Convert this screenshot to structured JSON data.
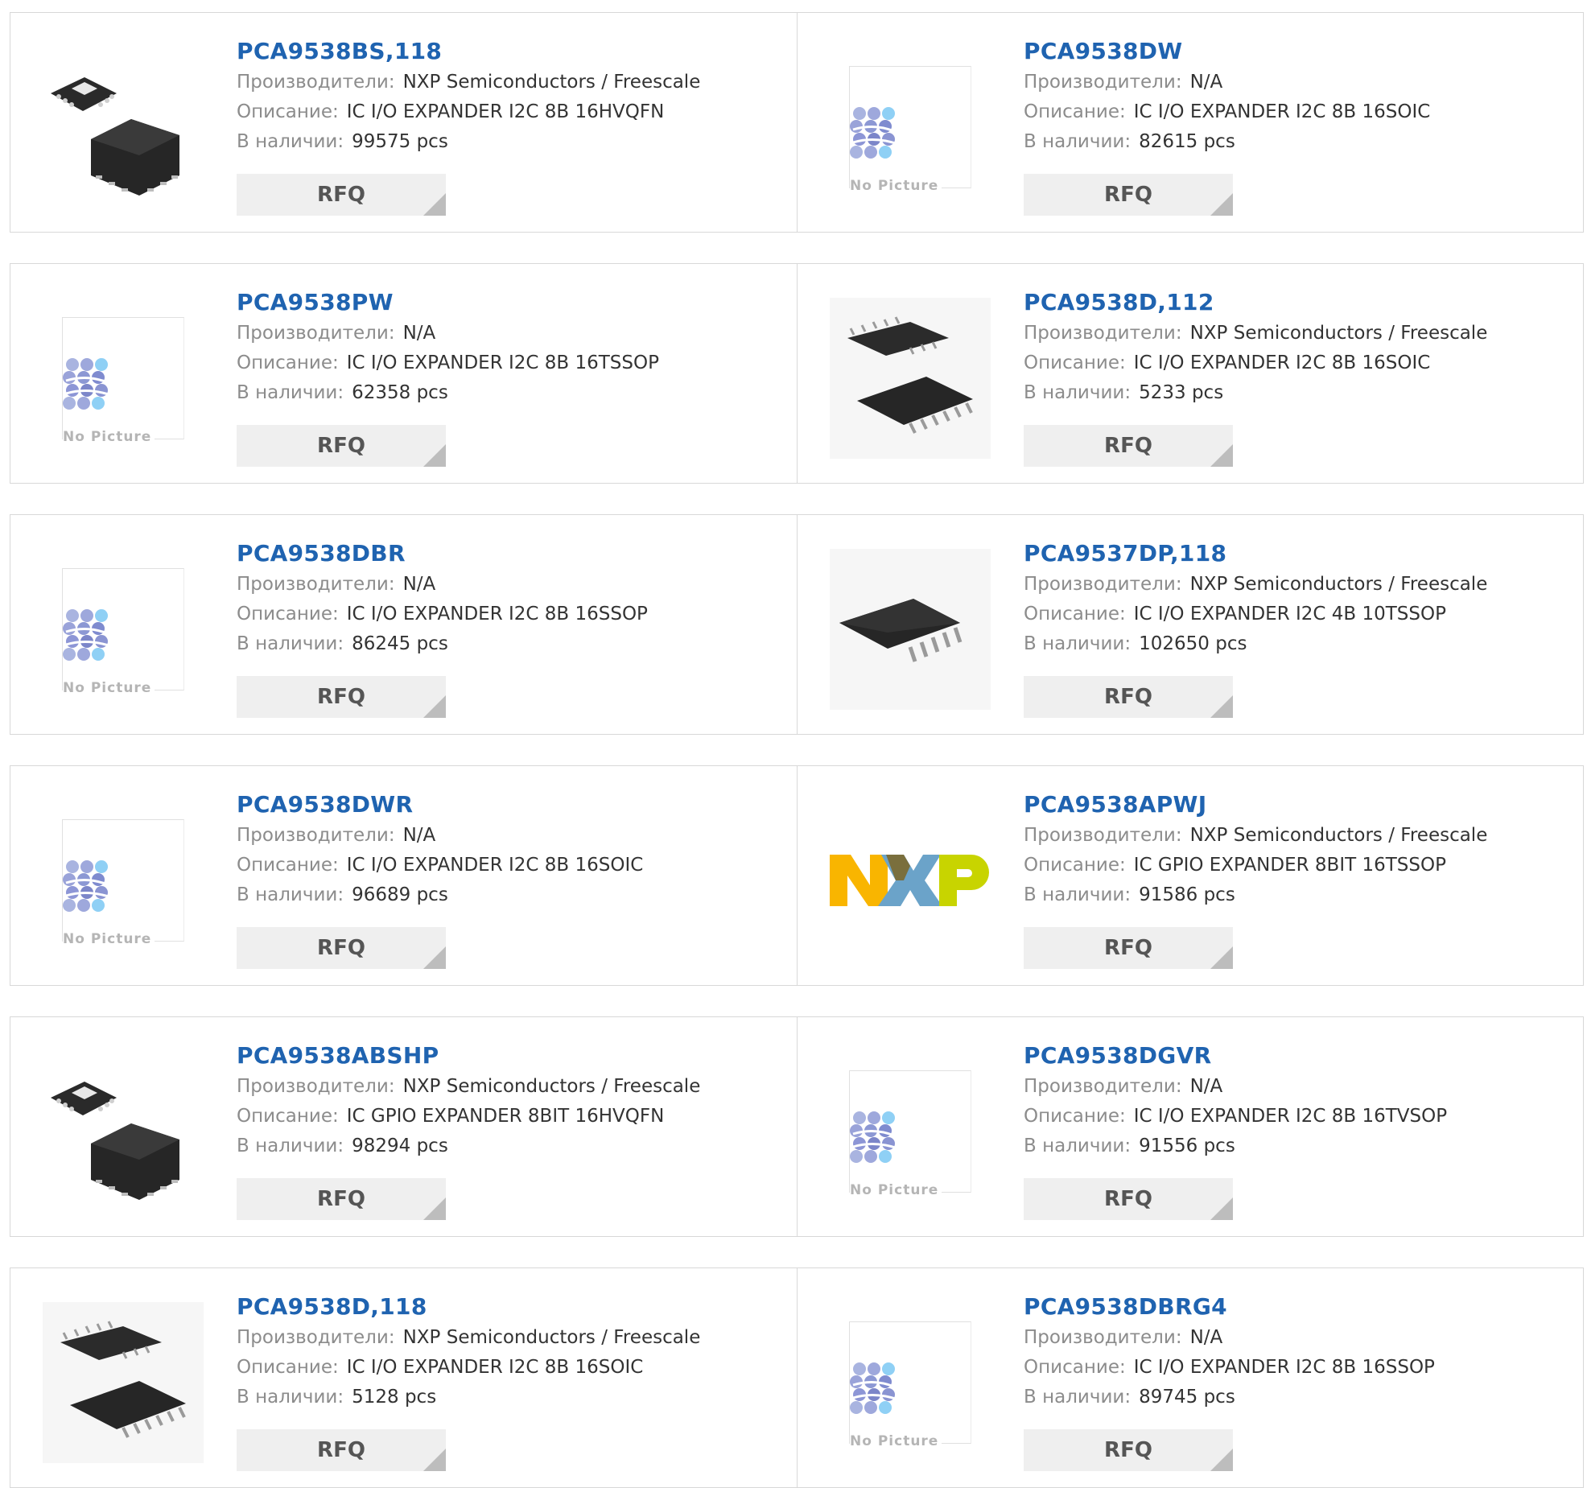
{
  "colors": {
    "part_number": "#1f63b0",
    "label": "#8c8c8c",
    "value": "#333333",
    "rfq_bg": "#efefef"
  },
  "rows": [
    {
      "left": {
        "pn": "PCA9538BS,118",
        "mfr_label": "Производители:",
        "mfr": "NXP Semiconductors / Freescale",
        "desc_label": "Описание:",
        "desc": "IC I/O EXPANDER I2C 8B 16HVQFN",
        "stock_label": "В наличии:",
        "stock": "99575 pcs",
        "rfq": "RFQ",
        "image": "qfn-chip-photo"
      },
      "right": {
        "pn": "PCA9538DW",
        "mfr_label": "Производители:",
        "mfr": "N/A",
        "desc_label": "Описание:",
        "desc": "IC I/O EXPANDER I2C 8B 16SOIC",
        "stock_label": "В наличии:",
        "stock": "82615 pcs",
        "rfq": "RFQ",
        "image": "no-picture",
        "no_picture_text": "No Picture"
      }
    },
    {
      "left": {
        "pn": "PCA9538PW",
        "mfr_label": "Производители:",
        "mfr": "N/A",
        "desc_label": "Описание:",
        "desc": "IC I/O EXPANDER I2C 8B 16TSSOP",
        "stock_label": "В наличии:",
        "stock": "62358 pcs",
        "rfq": "RFQ",
        "image": "no-picture",
        "no_picture_text": "No Picture"
      },
      "right": {
        "pn": "PCA9538D,112",
        "mfr_label": "Производители:",
        "mfr": "NXP Semiconductors / Freescale",
        "desc_label": "Описание:",
        "desc": "IC I/O EXPANDER I2C 8B 16SOIC",
        "stock_label": "В наличии:",
        "stock": "5233 pcs",
        "rfq": "RFQ",
        "image": "soic-chip-photo"
      }
    },
    {
      "left": {
        "pn": "PCA9538DBR",
        "mfr_label": "Производители:",
        "mfr": "N/A",
        "desc_label": "Описание:",
        "desc": "IC I/O EXPANDER I2C 8B 16SSOP",
        "stock_label": "В наличии:",
        "stock": "86245 pcs",
        "rfq": "RFQ",
        "image": "no-picture",
        "no_picture_text": "No Picture"
      },
      "right": {
        "pn": "PCA9537DP,118",
        "mfr_label": "Производители:",
        "mfr": "NXP Semiconductors / Freescale",
        "desc_label": "Описание:",
        "desc": "IC I/O EXPANDER I2C 4B 10TSSOP",
        "stock_label": "В наличии:",
        "stock": "102650 pcs",
        "rfq": "RFQ",
        "image": "tssop-chip-photo"
      }
    },
    {
      "left": {
        "pn": "PCA9538DWR",
        "mfr_label": "Производители:",
        "mfr": "N/A",
        "desc_label": "Описание:",
        "desc": "IC I/O EXPANDER I2C 8B 16SOIC",
        "stock_label": "В наличии:",
        "stock": "96689 pcs",
        "rfq": "RFQ",
        "image": "no-picture",
        "no_picture_text": "No Picture"
      },
      "right": {
        "pn": "PCA9538APWJ",
        "mfr_label": "Производители:",
        "mfr": "NXP Semiconductors / Freescale",
        "desc_label": "Описание:",
        "desc": "IC GPIO EXPANDER 8BIT 16TSSOP",
        "stock_label": "В наличии:",
        "stock": "91586 pcs",
        "rfq": "RFQ",
        "image": "nxp-logo"
      }
    },
    {
      "left": {
        "pn": "PCA9538ABSHP",
        "mfr_label": "Производители:",
        "mfr": "NXP Semiconductors / Freescale",
        "desc_label": "Описание:",
        "desc": "IC GPIO EXPANDER 8BIT 16HVQFN",
        "stock_label": "В наличии:",
        "stock": "98294 pcs",
        "rfq": "RFQ",
        "image": "qfn-chip-photo"
      },
      "right": {
        "pn": "PCA9538DGVR",
        "mfr_label": "Производители:",
        "mfr": "N/A",
        "desc_label": "Описание:",
        "desc": "IC I/O EXPANDER I2C 8B 16TVSOP",
        "stock_label": "В наличии:",
        "stock": "91556 pcs",
        "rfq": "RFQ",
        "image": "no-picture",
        "no_picture_text": "No Picture"
      }
    },
    {
      "left": {
        "pn": "PCA9538D,118",
        "mfr_label": "Производители:",
        "mfr": "NXP Semiconductors / Freescale",
        "desc_label": "Описание:",
        "desc": "IC I/O EXPANDER I2C 8B 16SOIC",
        "stock_label": "В наличии:",
        "stock": "5128 pcs",
        "rfq": "RFQ",
        "image": "soic-chip-photo"
      },
      "right": {
        "pn": "PCA9538DBRG4",
        "mfr_label": "Производители:",
        "mfr": "N/A",
        "desc_label": "Описание:",
        "desc": "IC I/O EXPANDER I2C 8B 16SSOP",
        "stock_label": "В наличии:",
        "stock": "89745 pcs",
        "rfq": "RFQ",
        "image": "no-picture",
        "no_picture_text": "No Picture"
      }
    }
  ]
}
